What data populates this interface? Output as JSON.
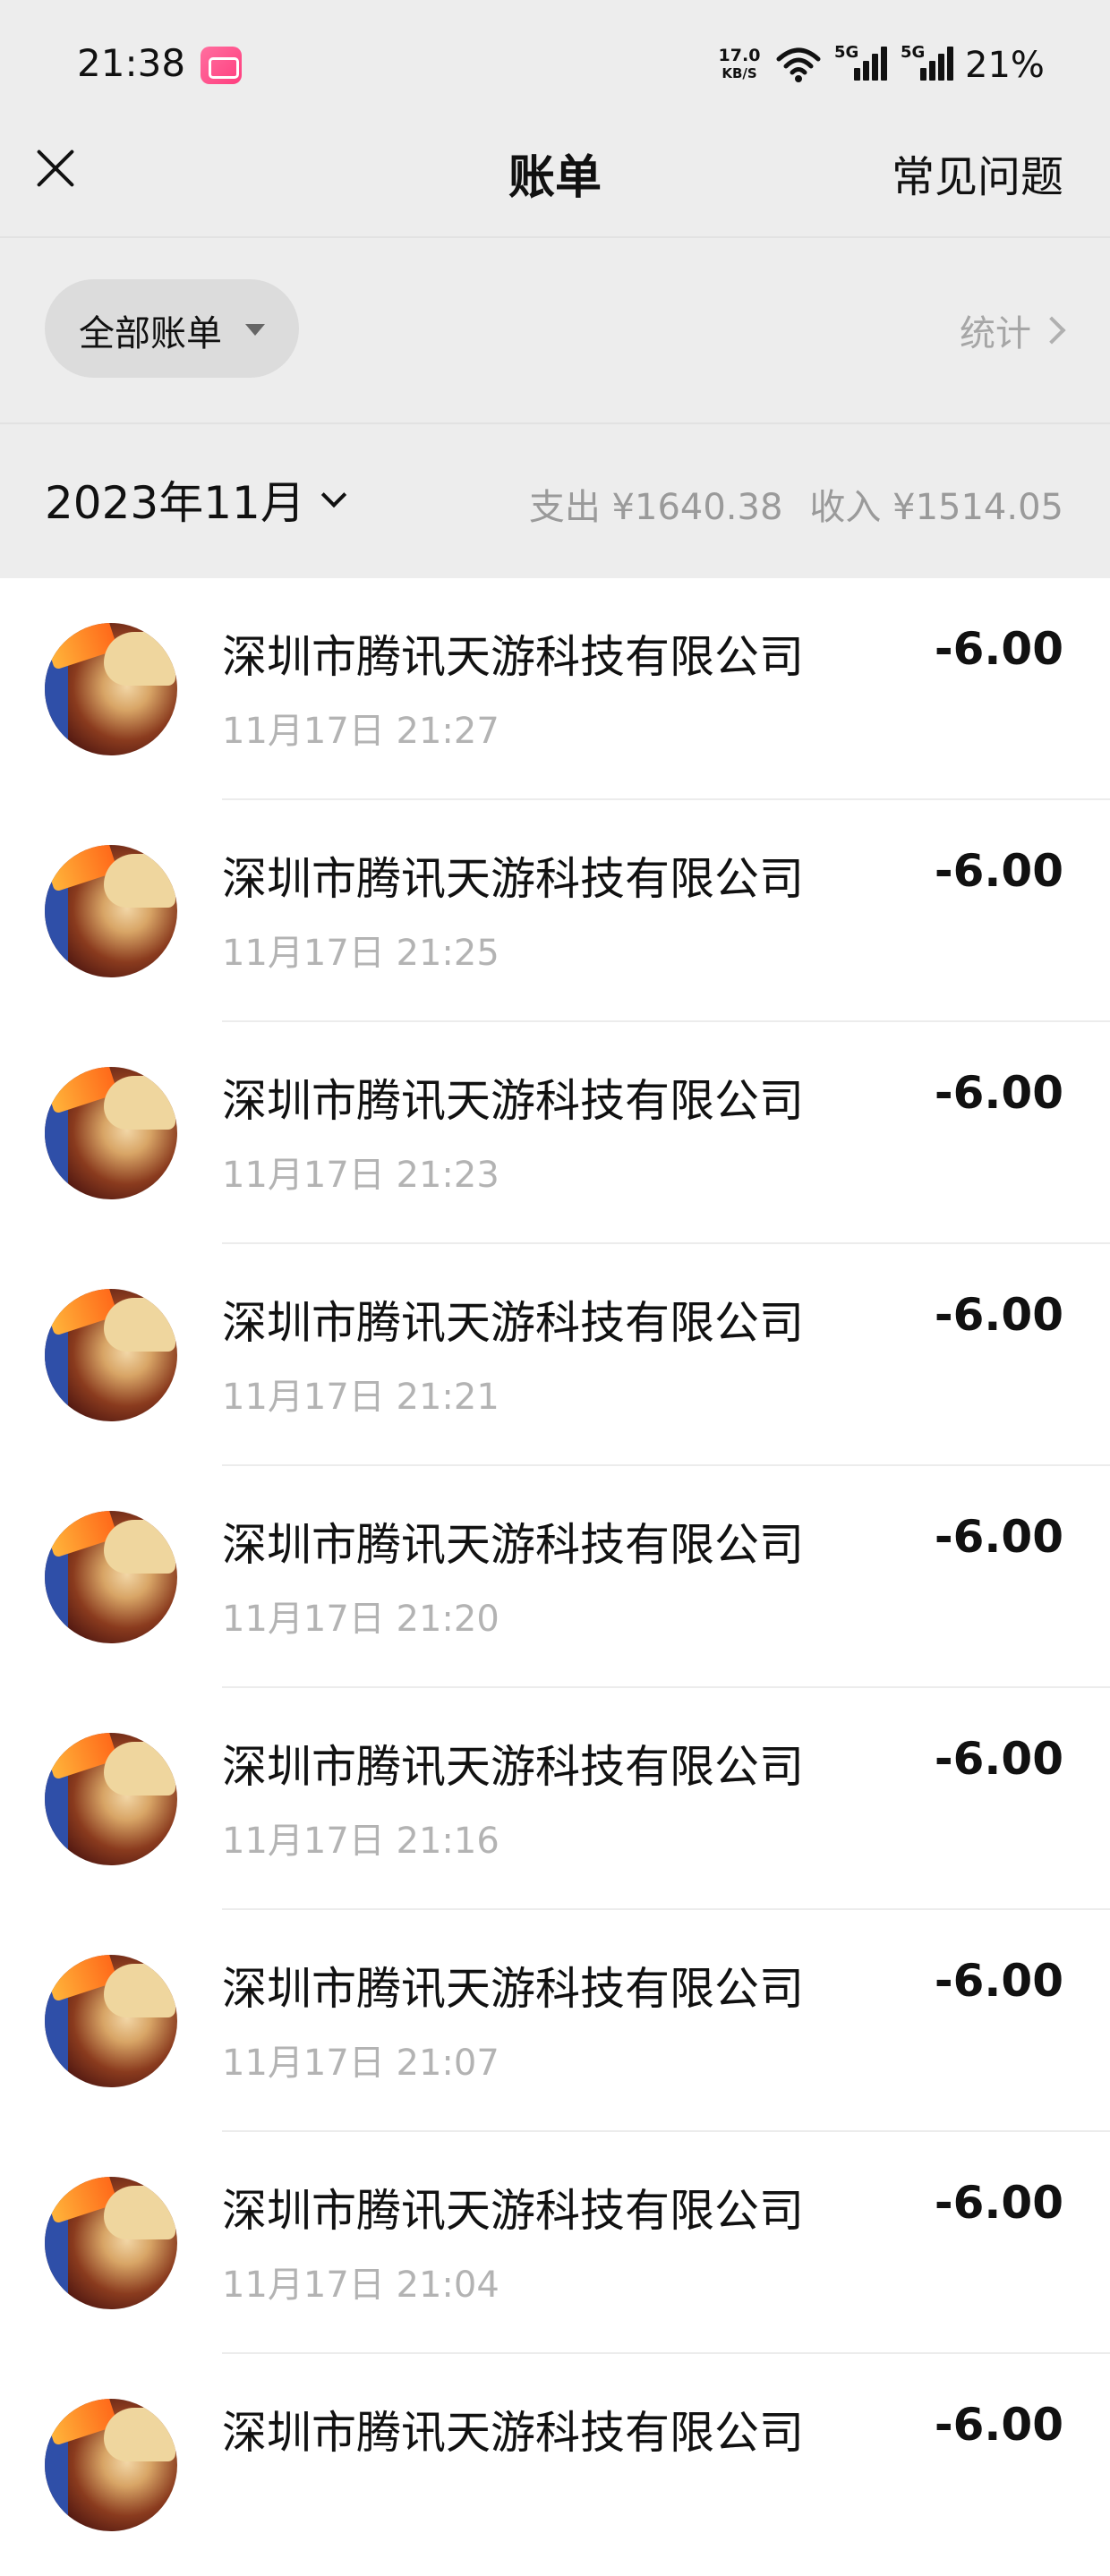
{
  "status_bar": {
    "time": "21:38",
    "net_speed_value": "17.0",
    "net_speed_unit": "KB/S",
    "sim1_label": "5G",
    "sim2_label": "5G",
    "battery": "21%",
    "app_icon": "bilibili-icon",
    "icons": [
      "wifi-icon",
      "signal-icon",
      "signal-icon"
    ]
  },
  "nav": {
    "close_icon": "close-icon",
    "title": "账单",
    "faq": "常见问题"
  },
  "filter": {
    "selected": "全部账单",
    "stats": "统计"
  },
  "month": {
    "label": "2023年11月",
    "expense": "支出 ¥1640.38",
    "income": "收入 ¥1514.05"
  },
  "transactions": [
    {
      "merchant": "深圳市腾讯天游科技有限公司",
      "time": "11月17日 21:27",
      "amount": "-6.00"
    },
    {
      "merchant": "深圳市腾讯天游科技有限公司",
      "time": "11月17日 21:25",
      "amount": "-6.00"
    },
    {
      "merchant": "深圳市腾讯天游科技有限公司",
      "time": "11月17日 21:23",
      "amount": "-6.00"
    },
    {
      "merchant": "深圳市腾讯天游科技有限公司",
      "time": "11月17日 21:21",
      "amount": "-6.00"
    },
    {
      "merchant": "深圳市腾讯天游科技有限公司",
      "time": "11月17日 21:20",
      "amount": "-6.00"
    },
    {
      "merchant": "深圳市腾讯天游科技有限公司",
      "time": "11月17日 21:16",
      "amount": "-6.00"
    },
    {
      "merchant": "深圳市腾讯天游科技有限公司",
      "time": "11月17日 21:07",
      "amount": "-6.00"
    },
    {
      "merchant": "深圳市腾讯天游科技有限公司",
      "time": "11月17日 21:04",
      "amount": "-6.00"
    },
    {
      "merchant": "深圳市腾讯天游科技有限公司",
      "time": "",
      "amount": "-6.00"
    }
  ],
  "colors": {
    "header_bg": "#ededed",
    "pill_bg": "#dcdcdc",
    "secondary_text": "#b3b3b3"
  }
}
